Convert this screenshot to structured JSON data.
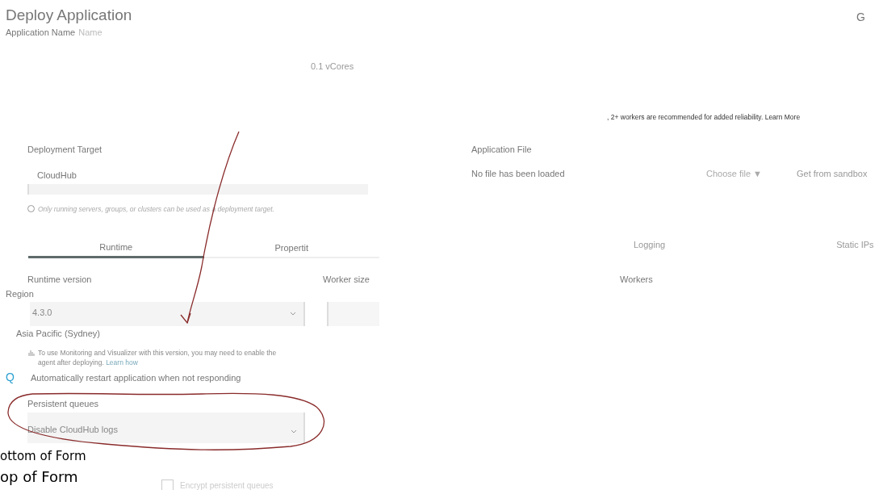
{
  "header": {
    "title": "Deploy Application",
    "app_name_label": "Application Name",
    "app_name_placeholder": "Name",
    "avatar": "G"
  },
  "vcores": "0.1 vCores",
  "workers_note": ", 2+ workers are recommended for added reliability. Learn More",
  "deployment_target": {
    "label": "Deployment Target",
    "value": "CloudHub",
    "hint": "Only running servers, groups, or clusters can be used as a deployment target."
  },
  "application_file": {
    "label": "Application File",
    "status": "No file has been loaded",
    "choose": "Choose file ▼",
    "sandbox": "Get from sandbox"
  },
  "tabs": [
    {
      "label": "Runtime",
      "selected": true
    },
    {
      "label": "Propertit",
      "selected": false
    },
    {
      "label": "Logging",
      "selected": false
    },
    {
      "label": "Static IPs",
      "selected": false
    }
  ],
  "runtime_version": {
    "label": "Runtime version",
    "value": "4.3.0"
  },
  "worker_size": {
    "label": "Worker size"
  },
  "workers": {
    "label": "Workers"
  },
  "region": {
    "label": "Region",
    "value": "Asia Pacific (Sydney)"
  },
  "monitoring_note": {
    "text": "To use Monitoring and Visualizer with this version, you may need to enable the agent after deploying.",
    "link": "Learn how"
  },
  "auto_restart": {
    "icon": "Q",
    "label": "Automatically restart application when not responding"
  },
  "persistent_queues": {
    "label": "Persistent queues",
    "value": "Disable CloudHub logs"
  },
  "form_markers": [
    "ottom of Form",
    "op of Form"
  ],
  "encrypt": {
    "label": "Encrypt persistent queues",
    "checked": false
  }
}
